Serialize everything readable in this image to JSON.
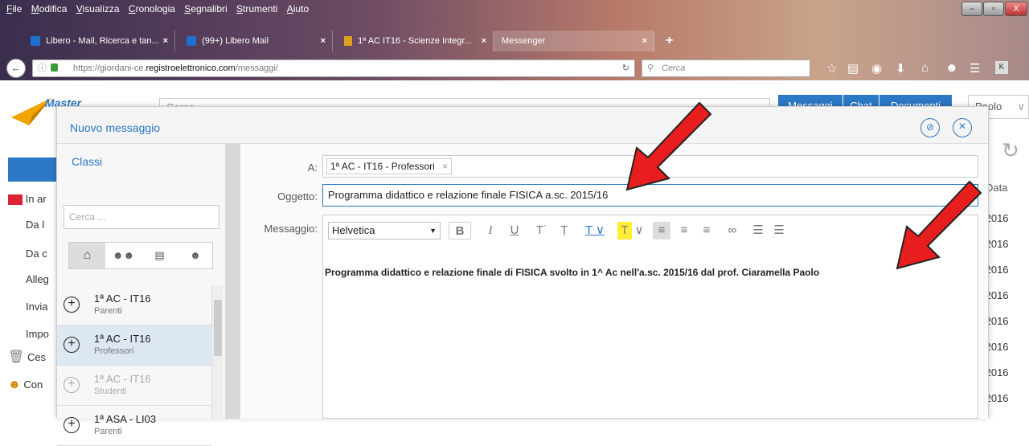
{
  "browser": {
    "menu": [
      "File",
      "Modifica",
      "Visualizza",
      "Cronologia",
      "Segnalibri",
      "Strumenti",
      "Aiuto"
    ],
    "tabs": [
      {
        "label": "Libero - Mail, Ricerca e tan...",
        "close": "×"
      },
      {
        "label": "(99+) Libero Mail",
        "close": "×"
      },
      {
        "label": "1ª AC IT16 - Scienze Integr...",
        "close": "×"
      },
      {
        "label": "Messenger",
        "close": "×"
      }
    ],
    "new_tab": "+",
    "url_prefix": "https://giordani-ce.",
    "url_domain": "registroelettronico.com",
    "url_path": "/messaggi/",
    "search_placeholder": "Cerca",
    "window_buttons": [
      "–",
      "▫",
      "X"
    ]
  },
  "app": {
    "logo_text": "Master",
    "search_placeholder": "Cerca",
    "top_buttons": [
      "Messaggi",
      "Chat",
      "Documenti"
    ],
    "user": "Paolo",
    "sidebar": [
      "In ar",
      "Da l",
      "Da c",
      "Alleg",
      "Invia",
      "Impo",
      "Ces",
      "Con"
    ],
    "date_header": "Data",
    "dates": [
      "/2016",
      "/2016",
      "/2016",
      "/2016",
      "/2016",
      "/2016",
      "/2016",
      "/2016"
    ]
  },
  "modal": {
    "title": "Nuovo messaggio",
    "classes_title": "Classi",
    "search_placeholder": "Cerca ...",
    "list": [
      {
        "name": "1ª AC - IT16",
        "sub": "Parenti",
        "dim": false
      },
      {
        "name": "1ª AC - IT16",
        "sub": "Professori",
        "dim": false
      },
      {
        "name": "1ª AC - IT16",
        "sub": "Studenti",
        "dim": true
      },
      {
        "name": "1ª ASA - LI03",
        "sub": "Parenti",
        "dim": false
      }
    ],
    "to_label": "A:",
    "recipient": "1ª AC - IT16 - Professori",
    "subject_label": "Oggetto:",
    "subject": "Programma didattico e relazione finale FISICA a.sc. 2015/16",
    "message_label": "Messaggio:",
    "font": "Helvetica",
    "body": "Programma didattico e relazione finale di FISICA svolto in 1^ Ac nell'a.sc. 2015/16 dal prof. Ciaramella Paolo",
    "accent": "#2b78c4"
  }
}
